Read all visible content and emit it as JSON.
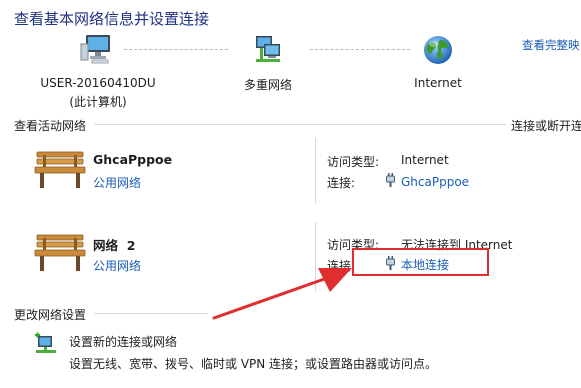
{
  "header": {
    "title": "查看基本网络信息并设置连接",
    "see_full_map": "查看完整映"
  },
  "network_map": {
    "nodes": [
      {
        "label": "USER-20160410DU",
        "sublabel": "(此计算机)",
        "icon": "computer-icon"
      },
      {
        "label": "多重网络",
        "sublabel": "",
        "icon": "multiple-networks-icon"
      },
      {
        "label": "Internet",
        "sublabel": "",
        "icon": "globe-icon"
      }
    ]
  },
  "active_networks": {
    "header": "查看活动网络",
    "action_link": "连接或断开连",
    "networks": [
      {
        "name": "GhcaPppoe",
        "type": "公用网络",
        "icon": "park-bench-icon",
        "access_label": "访问类型:",
        "access_value": "Internet",
        "connection_label": "连接:",
        "connection_value": "GhcaPppoe"
      },
      {
        "name": "网络  2",
        "type": "公用网络",
        "icon": "park-bench-icon",
        "access_label": "访问类型:",
        "access_value": "无法连接到 Internet",
        "connection_label": "连接:",
        "connection_value": "本地连接"
      }
    ]
  },
  "change_settings": {
    "header": "更改网络设置",
    "tasks": [
      {
        "link": "设置新的连接或网络",
        "description": "设置无线、宽带、拨号、临时或 VPN 连接；或设置路由器或访问点。",
        "icon": "new-connection-icon"
      }
    ]
  },
  "colors": {
    "link": "#1a5cb8",
    "title": "#1e3287",
    "annotation_red": "#e02d2d"
  }
}
